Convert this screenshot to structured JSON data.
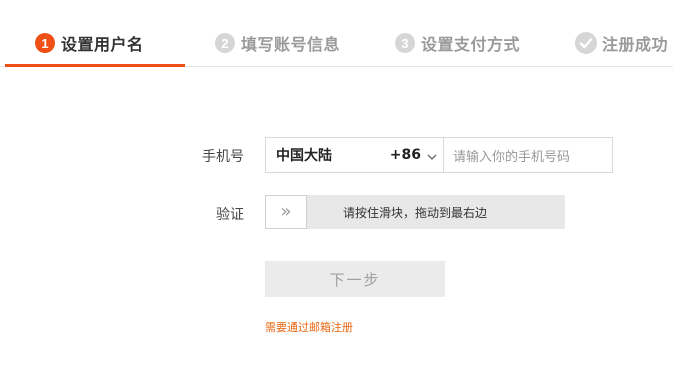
{
  "steps": [
    {
      "number": "1",
      "label": "设置用户名"
    },
    {
      "number": "2",
      "label": "填写账号信息"
    },
    {
      "number": "3",
      "label": "设置支付方式"
    },
    {
      "number": "",
      "label": "注册成功"
    }
  ],
  "form": {
    "phone_label": "手机号",
    "country_name": "中国大陆",
    "country_code": "+86",
    "phone_placeholder": "请输入你的手机号码",
    "verify_label": "验证",
    "slider_arrow": "»",
    "slider_text": "请按住滑块，拖动到最右边",
    "next_button": "下一步",
    "email_link": "需要通过邮箱注册"
  },
  "colors": {
    "accent": "#f04f16",
    "link": "#e8650f",
    "inactive": "#d6d6d6"
  }
}
